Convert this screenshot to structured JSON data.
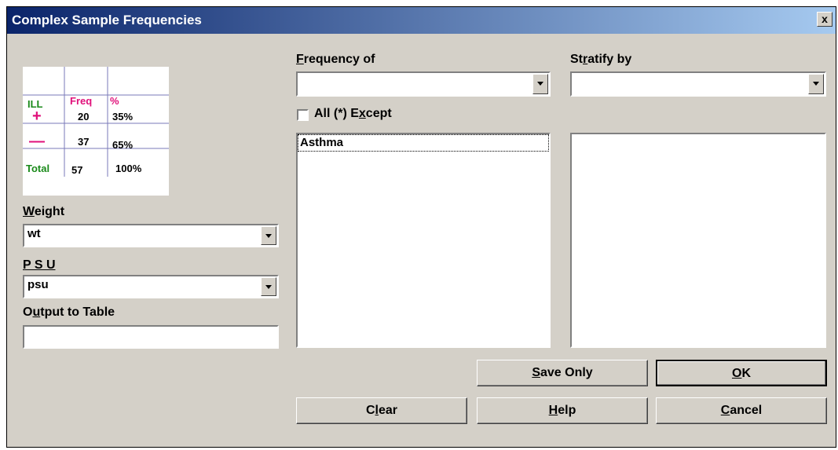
{
  "window": {
    "title": "Complex Sample Frequencies",
    "close_label": "x"
  },
  "legend": {
    "headers": {
      "ill": "ILL",
      "freq": "Freq",
      "pct": "%"
    },
    "rows": [
      {
        "sign": "+",
        "freq": "20",
        "pct": "35%"
      },
      {
        "sign": "—",
        "freq": "37",
        "pct": "65%"
      },
      {
        "sign": "Total",
        "freq": "57",
        "pct": "100%"
      }
    ],
    "colors": {
      "sign_plus_minus": "#e0107a",
      "header_ill": "#1a8a1a",
      "header_freq": "#e0107a",
      "total": "#1a8a1a",
      "rule": "#7a7ab8"
    }
  },
  "weight": {
    "label_mnemonic": "W",
    "label_rest": "eight",
    "value": "wt"
  },
  "psu": {
    "label": "P S U",
    "value": "psu"
  },
  "output": {
    "label_pre": "O",
    "label_mnemonic": "u",
    "label_rest": "tput to Table",
    "value": ""
  },
  "frequency_of": {
    "label_mnemonic": "F",
    "label_rest": "requency of",
    "value": "",
    "items": [
      "Asthma"
    ]
  },
  "stratify_by": {
    "label_pre": "St",
    "label_mnemonic": "r",
    "label_rest": "atify by",
    "value": ""
  },
  "all_except": {
    "label_pre": "All (*) E",
    "label_mnemonic": "x",
    "label_rest": "cept",
    "checked": false
  },
  "buttons": {
    "save_only": {
      "mnemonic": "S",
      "rest": "ave Only"
    },
    "ok": {
      "mnemonic": "O",
      "rest": "K"
    },
    "clear": {
      "pre": "C",
      "mnemonic": "l",
      "rest": "ear"
    },
    "help": {
      "mnemonic": "H",
      "rest": "elp"
    },
    "cancel": {
      "mnemonic": "C",
      "rest": "ancel"
    }
  }
}
